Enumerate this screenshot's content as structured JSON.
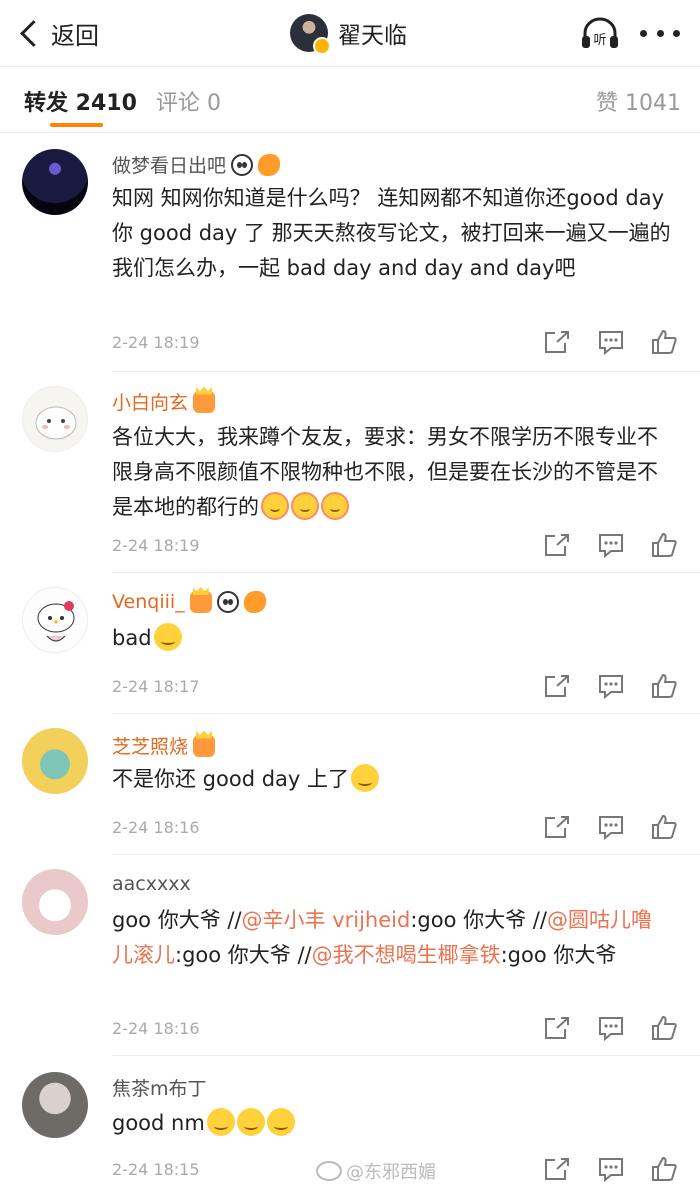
{
  "nav": {
    "back_label": "返回",
    "title": "翟天临",
    "listen_label": "听"
  },
  "tabs": [
    {
      "label": "转发 2410",
      "active": true
    },
    {
      "label": "评论 0",
      "active": false
    },
    {
      "label": "赞 1041",
      "active": false
    }
  ],
  "comments": [
    {
      "username": "做梦看日出吧",
      "name_color": "grey",
      "badges": [
        "panda-emoji",
        "fish-emoji"
      ],
      "text": "知网 知网你知道是什么吗？ 连知网都不知道你还good day 你 good day 了 那天天熬夜写论文，被打回来一遍又一遍的我们怎么办，一起 bad day and day and day吧",
      "time": "2-24 18:19"
    },
    {
      "username": "小白向玄",
      "name_color": "orange",
      "badges": [
        "crown-badge"
      ],
      "text": "各位大大，我来蹲个友友，要求：男女不限学历不限专业不限身高不限颜值不限物种也不限，但是要在长沙的不管是不是本地的都行的",
      "emojis": [
        "cry-emoji",
        "cry-emoji",
        "cry-emoji"
      ],
      "time": "2-24 18:19"
    },
    {
      "username": "Venqiii_",
      "name_color": "orange",
      "badges": [
        "crown-badge",
        "panda-emoji",
        "fish-emoji"
      ],
      "text": "bad",
      "emojis": [
        "smile-emoji"
      ],
      "time": "2-24 18:17"
    },
    {
      "username": "芝芝照烧",
      "name_color": "orange",
      "badges": [
        "crown-badge"
      ],
      "text": "不是你还 good day 上了",
      "emojis": [
        "smile-emoji"
      ],
      "time": "2-24 18:16"
    },
    {
      "username": "aacxxxx",
      "name_color": "grey",
      "badges": [],
      "parts": [
        {
          "t": "goo 你大爷 //"
        },
        {
          "t": "@辛小丰 vrijheid",
          "mention": true
        },
        {
          "t": ":goo 你大爷 //"
        },
        {
          "t": "@圆咕儿噜儿滚儿",
          "mention": true
        },
        {
          "t": ":goo 你大爷 //"
        },
        {
          "t": "@我不想喝生椰拿铁",
          "mention": true
        },
        {
          "t": ":goo 你大爷"
        }
      ],
      "time": "2-24 18:16"
    },
    {
      "username": "焦茶m布丁",
      "name_color": "grey",
      "badges": [],
      "text": "good nm",
      "emojis": [
        "sweat-emoji",
        "sweat-emoji",
        "sweat-emoji"
      ],
      "time": "2-24 18:15"
    }
  ],
  "watermark": "@东邪西媚",
  "colors": {
    "accent": "#ff8200",
    "username_orange": "#e4691f",
    "mention": "#eb7350"
  }
}
